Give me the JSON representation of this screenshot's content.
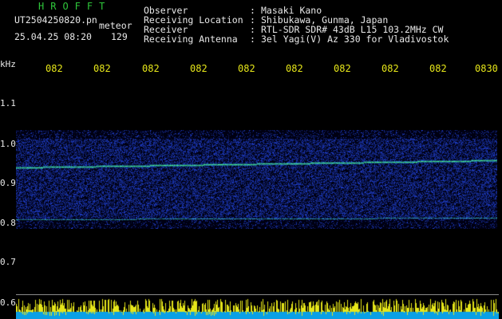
{
  "brand": "HROFFT",
  "file": {
    "name": "UT2504250820.pn",
    "type": "meteor",
    "datetime": "25.04.25 08:20",
    "count": "129"
  },
  "meta": {
    "labels": [
      "Observer",
      "Receiving Location",
      "Receiver",
      "Receiving Antenna"
    ],
    "values": [
      "Masaki Kano",
      "Shibukawa, Gunma, Japan",
      "RTL-SDR SDR# 43dB L15 103.2MHz CW",
      "3el Yagi(V) Az 330 for Vladivostok"
    ]
  },
  "axis": {
    "y_unit": "kHz",
    "y_ticks": [
      "1.1",
      "1.0",
      "0.9",
      "0.8",
      "0.7",
      "0.6"
    ],
    "x_ticks": [
      "082",
      "082",
      "082",
      "082",
      "082",
      "082",
      "082",
      "082",
      "082",
      "0830"
    ]
  },
  "colors": {
    "brand": "#2ec63a",
    "text": "#e8e8e8",
    "ticks": "#e6e619",
    "spectrum_fill": "#0aa0e6",
    "spectrum_peaks": "#e6e619"
  }
}
